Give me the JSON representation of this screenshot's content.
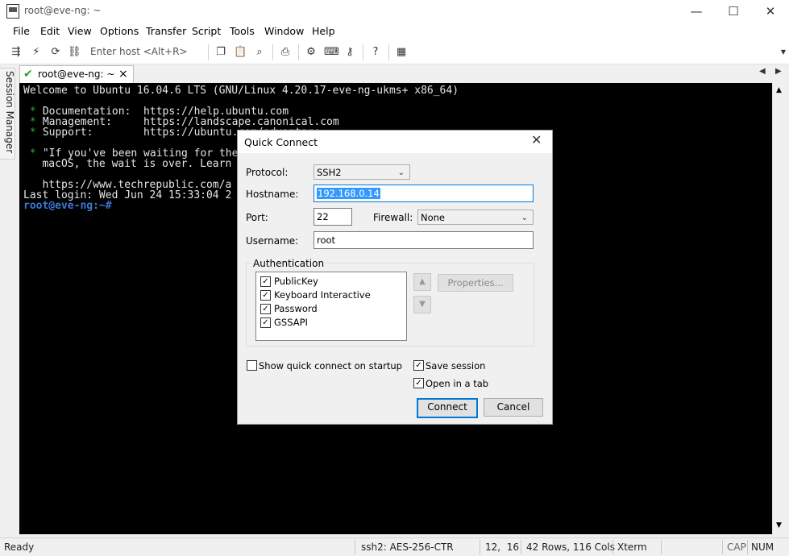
{
  "window": {
    "title": "root@eve-ng: ~",
    "buttons": {
      "minimize": "—",
      "maximize": "☐",
      "close": "✕"
    }
  },
  "menu": [
    "File",
    "Edit",
    "View",
    "Options",
    "Transfer",
    "Script",
    "Tools",
    "Window",
    "Help"
  ],
  "toolbar": {
    "host_placeholder": "Enter host <Alt+R>",
    "icons": [
      "connect-icon",
      "quick-connect-icon",
      "reconnect-icon",
      "disconnect-icon",
      "copy-icon",
      "paste-icon",
      "find-icon",
      "print-icon",
      "settings-icon",
      "keymap-icon",
      "sftp-icon",
      "help-icon",
      "screen-icon"
    ]
  },
  "session_manager": {
    "label": "Session Manager"
  },
  "tab": {
    "label": "root@eve-ng: ~",
    "close": "×"
  },
  "terminal": {
    "line1": "Welcome to Ubuntu 16.04.6 LTS (GNU/Linux 4.20.17-eve-ng-ukms+ x86_64)",
    "line2_bullet": " *",
    "line2": " Documentation:  https://help.ubuntu.com",
    "line3_bullet": " *",
    "line3": " Management:     https://landscape.canonical.com",
    "line4_bullet": " *",
    "line4": " Support:        https://ubuntu.com/advantage",
    "line5_bullet": " *",
    "line5": " \"If you've been waiting for the",
    "line6": "   macOS, the wait is over. Learn",
    "line7": "   https://www.techrepublic.com/a",
    "line8": "Last login: Wed Jun 24 15:33:04 2",
    "prompt": "root@eve-ng:~#"
  },
  "status": {
    "ready": "Ready",
    "cipher": "ssh2: AES-256-CTR",
    "cursor": "12,  16",
    "size": "42 Rows, 116 Cols",
    "emulation": "Xterm",
    "cap": "CAP",
    "num": "NUM"
  },
  "dialog": {
    "title": "Quick Connect",
    "protocol_label": "Protocol:",
    "protocol_value": "SSH2",
    "hostname_label": "Hostname:",
    "hostname_value": "192.168.0.14",
    "port_label": "Port:",
    "port_value": "22",
    "firewall_label": "Firewall:",
    "firewall_value": "None",
    "username_label": "Username:",
    "username_value": "root",
    "auth_label": "Authentication",
    "auth_methods": [
      {
        "label": "PublicKey",
        "checked": true
      },
      {
        "label": "Keyboard Interactive",
        "checked": true
      },
      {
        "label": "Password",
        "checked": true
      },
      {
        "label": "GSSAPI",
        "checked": true
      }
    ],
    "properties_label": "Properties...",
    "show_on_startup_label": "Show quick connect on startup",
    "show_on_startup_checked": false,
    "save_session_label": "Save session",
    "save_session_checked": true,
    "open_in_tab_label": "Open in a tab",
    "open_in_tab_checked": true,
    "connect_label": "Connect",
    "cancel_label": "Cancel"
  }
}
